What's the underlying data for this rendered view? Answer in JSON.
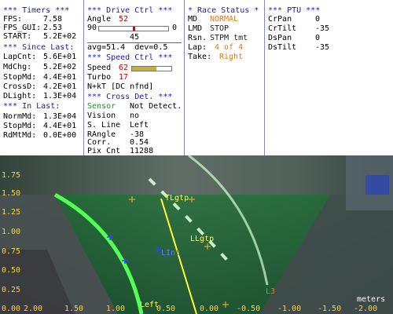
{
  "timers": {
    "header": "*** Timers ***",
    "rows": [
      {
        "k": "FPS:",
        "v": "7.58"
      },
      {
        "k": "FPS_GUI:",
        "v": "2.53"
      },
      {
        "k": "START:",
        "v": "5.2E+02"
      }
    ],
    "since_header": "*** Since Last:",
    "since_rows": [
      {
        "k": "LapCnt:",
        "v": "5.6E+01"
      },
      {
        "k": "MdChg:",
        "v": "5.2E+02"
      },
      {
        "k": "StopMd:",
        "v": "4.4E+01"
      },
      {
        "k": "CrossD:",
        "v": "4.2E+01"
      },
      {
        "k": "DLight:",
        "v": "1.3E+04"
      }
    ],
    "in_header": "*** In Last:",
    "in_rows": [
      {
        "k": "NormMd:",
        "v": "1.3E+04"
      },
      {
        "k": "StopMd:",
        "v": "4.4E+01"
      },
      {
        "k": "RdMtMd:",
        "v": "0.0E+00"
      }
    ]
  },
  "drive": {
    "header": "*** Drive Ctrl ***",
    "angle_label": "Angle",
    "angle_value": "52",
    "slider_min": "90",
    "slider_max": "0",
    "slider_value": "45",
    "slider_fraction": 0.5,
    "avg_line": "avg=51.4  dev=0.5",
    "speed_header": "*** Speed Ctrl ***",
    "speed_label": "Speed",
    "speed_value": "62",
    "speed_fraction": 0.62,
    "turbo_label": "Turbo",
    "turbo_value": "17",
    "nkt_line": "N+kT [DC nfnd]",
    "cross_header": "*** Cross Det. ***",
    "cross_rows": [
      {
        "k": "Sensor",
        "v": "Not Detect."
      },
      {
        "k": "Vision",
        "v": "no"
      },
      {
        "k": "S. Line",
        "v": "Left"
      },
      {
        "k": "RAngle",
        "v": "-38"
      },
      {
        "k": "Corr.",
        "v": "0.54"
      },
      {
        "k": "Pix Cnt",
        "v": "11288"
      }
    ]
  },
  "race": {
    "header": "* Race Status *",
    "md_label": "MD",
    "md_value": "NORMAL",
    "lmd_label": "LMD",
    "lmd_value": "STOP",
    "rsn_label": "Rsn.",
    "rsn_value": "STPM tmt",
    "lap_label": "Lap:",
    "lap_value": "4 of 4",
    "take_label": "Take:",
    "take_value": "Right"
  },
  "ptu": {
    "header": "*** PTU ***",
    "rows": [
      {
        "k": "CrPan",
        "v": "0"
      },
      {
        "k": "CrTilt",
        "v": "-35"
      },
      {
        "k": "DsPan",
        "v": "0"
      },
      {
        "k": "DsTilt",
        "v": "-35"
      }
    ]
  },
  "camera": {
    "y_ticks": [
      "1.75",
      "1.50",
      "1.25",
      "1.00",
      "0.75",
      "0.50",
      "0.25",
      "0.00"
    ],
    "x_ticks": [
      "2.00",
      "1.50",
      "1.00",
      "0.50",
      "0.00",
      "-0.50",
      "-1.00",
      "-1.50",
      "-2.00"
    ],
    "units": "meters",
    "labels": {
      "tlgtp": "TLgtp",
      "llgtp": "LLgtp",
      "lint": "LInt",
      "left": "Left",
      "marker": "L3"
    }
  }
}
